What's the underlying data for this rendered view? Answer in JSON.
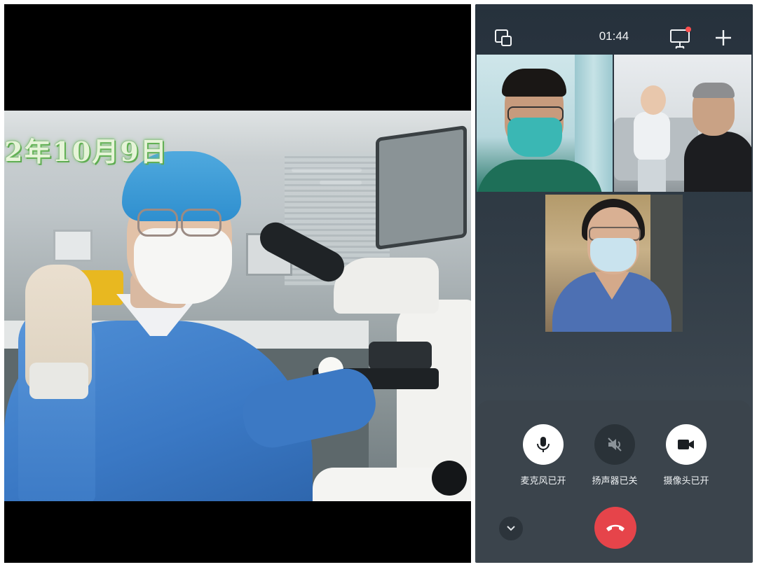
{
  "video_frame": {
    "date_overlay": "2年10月9日"
  },
  "call": {
    "timer": "01:44",
    "icons": {
      "pip": "picture-in-picture-icon",
      "screen_share": "screen-share-icon",
      "add": "plus-icon"
    },
    "participants_tiles": 3,
    "controls": [
      {
        "id": "mic",
        "label": "麦克风已开",
        "state": "on",
        "icon": "microphone-icon"
      },
      {
        "id": "speaker",
        "label": "扬声器已关",
        "state": "off",
        "icon": "speaker-muted-icon"
      },
      {
        "id": "camera",
        "label": "摄像头已开",
        "state": "on",
        "icon": "video-camera-icon"
      }
    ],
    "hangup_icon": "phone-hangup-icon",
    "collapse_icon": "chevron-down-icon"
  },
  "colors": {
    "panel_bg": "#2e3942",
    "hangup": "#e6444a",
    "notification_dot": "#ff4d4d",
    "date_overlay": "#e6f4d8"
  }
}
